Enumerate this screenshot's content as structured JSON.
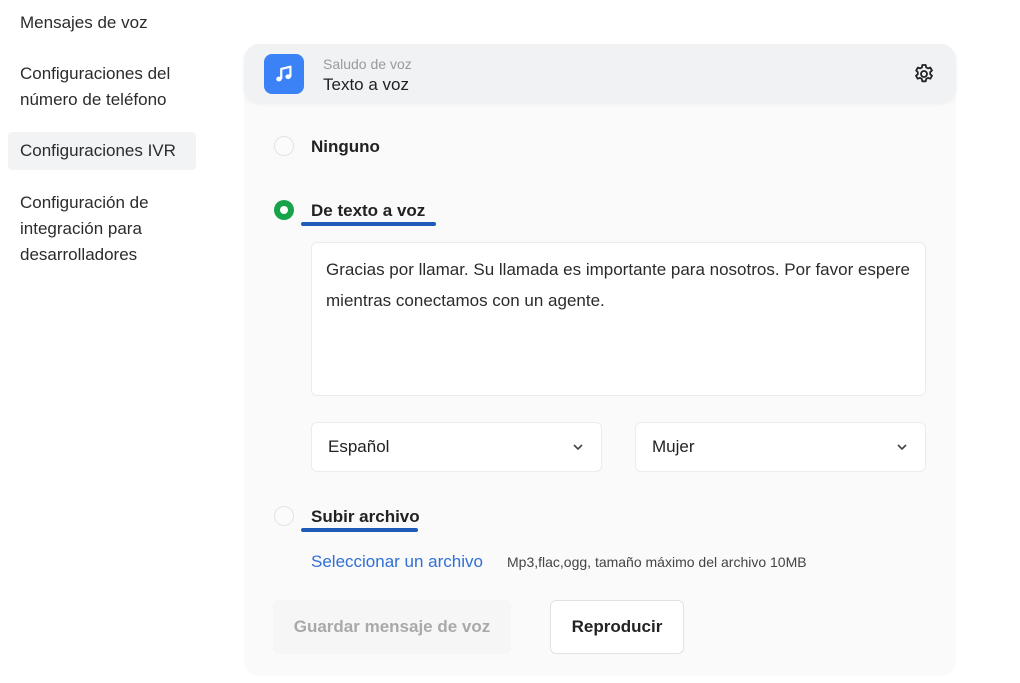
{
  "sidebar": {
    "items": [
      {
        "label": "Mensajes de voz"
      },
      {
        "label": "Configuraciones del número de teléfono"
      },
      {
        "label": "Configuraciones IVR"
      },
      {
        "label": "Configuración de integración para desarrolladores"
      }
    ]
  },
  "header": {
    "subtitle": "Saludo de voz",
    "title": "Texto a voz",
    "icon": "music-note-icon",
    "icon_color": "#3b82f6"
  },
  "options": {
    "none_label": "Ninguno",
    "tts_label": "De texto a voz",
    "upload_label": "Subir archivo",
    "selected": "De texto a voz"
  },
  "tts": {
    "message": "Gracias por llamar. Su llamada es importante para nosotros. Por favor espere mientras conectamos con un agente.",
    "language": "Español",
    "voice": "Mujer"
  },
  "upload": {
    "link_label": "Seleccionar un archivo",
    "hint": "Mp3,flac,ogg, tamaño máximo del archivo 10MB"
  },
  "actions": {
    "save_label": "Guardar mensaje de voz",
    "play_label": "Reproducir"
  },
  "colors": {
    "accent_green": "#16a34a",
    "link_blue": "#2f6fd6",
    "annotation_underline": "#1e5bb8"
  }
}
